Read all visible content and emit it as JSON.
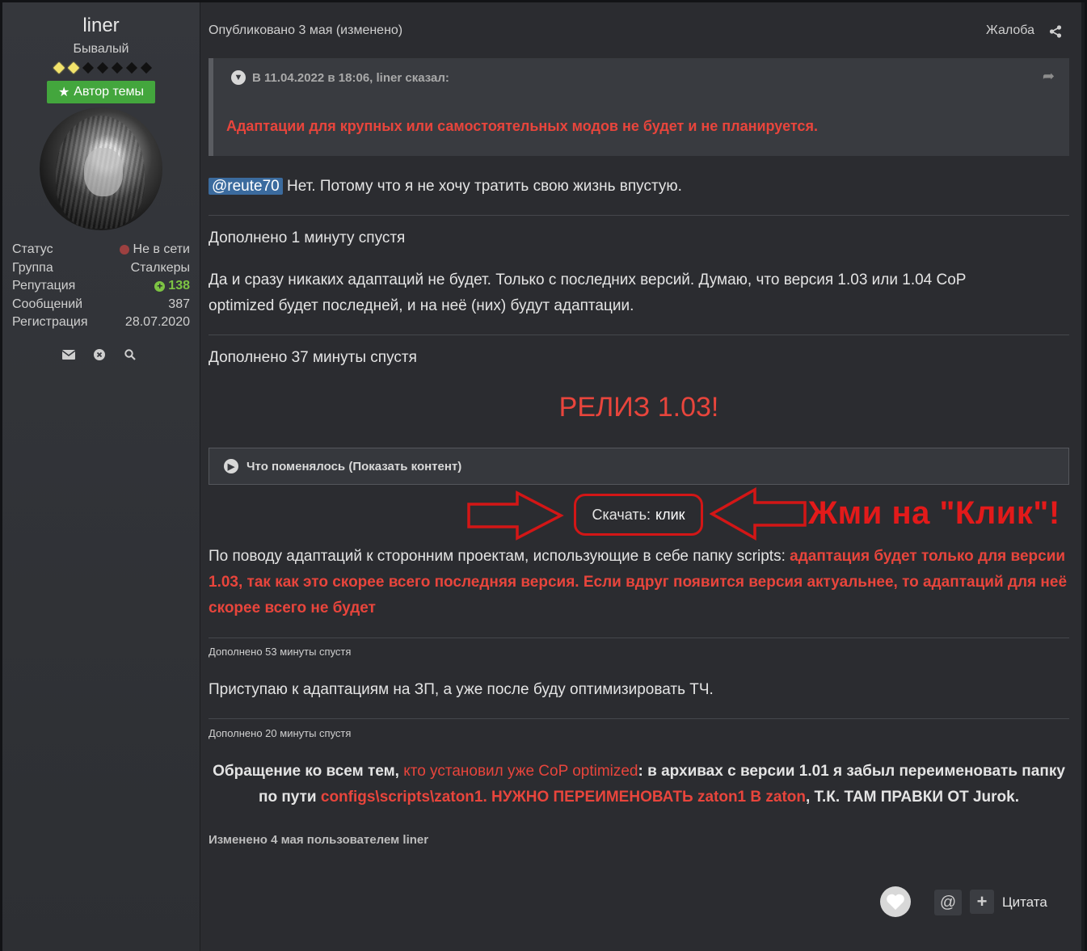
{
  "sidebar": {
    "username": "liner",
    "rank": "Бывалый",
    "rank_pips_on": 2,
    "rank_pips_total": 7,
    "author_badge": "Автор темы",
    "stats": [
      {
        "label": "Статус",
        "value": "Не в сети"
      },
      {
        "label": "Группа",
        "value": "Сталкеры"
      },
      {
        "label": "Репутация",
        "value": "138"
      },
      {
        "label": "Сообщений",
        "value": "387"
      },
      {
        "label": "Регистрация",
        "value": "28.07.2020"
      }
    ]
  },
  "post": {
    "meta": "Опубликовано 3 мая (изменено)",
    "report": "Жалоба",
    "quote": {
      "header": "В 11.04.2022 в 18:06, liner сказал:",
      "text": "Адаптации для крупных или самостоятельных модов не будет и не планируется."
    },
    "mention": "@reute70",
    "reply_text": " Нет. Потому что я не хочу тратить свою жизнь впустую.",
    "added1": "Дополнено 1 минуту спустя",
    "para1_line1": "Да и сразу никаких адаптаций не будет. Только с последних версий. Думаю, что версия 1.03 или 1.04 CoP",
    "para1_line2": "optimized будет последней, и на неё (них) будут адаптации.",
    "added2": "Дополнено 37 минуты спустя",
    "release": "РЕЛИЗ 1.03!",
    "spoiler": "Что поменялось (Показать контент)",
    "download_label": "Скачать:",
    "download_link": "клик",
    "annotation": "Жми на \"Клик\"!",
    "para2_plain": "По поводу адаптаций к сторонним проектам, использующие в себе папку scripts: ",
    "para2_red": "адаптация будет только для версии 1.03, так как это скорее всего последняя версия. Если вдруг появится версия актуальнее, то адаптаций для неё скорее всего не будет",
    "added3": "Дополнено 53 минуты спустя",
    "para3": "Приступаю к адаптациям на ЗП, а уже после буду оптимизировать ТЧ.",
    "added4": "Дополнено 20 минуты спустя",
    "para4_a": "Обращение ко всем тем, ",
    "para4_b": "кто установил уже CoP optimized",
    "para4_c": ": в архивах с версии 1.01 я забыл переименовать папку по пути ",
    "para4_d": "configs\\scripts\\zaton1.  НУЖНО ПЕРЕИМЕНОВАТЬ zaton1 В zaton",
    "para4_e": ", Т.К. ТАМ ПРАВКИ ОТ Jurok.",
    "edited": "Изменено 4 мая пользователем liner",
    "quote_button": "Цитата",
    "mention_button": "@",
    "plus_button": "+"
  },
  "colors": {
    "accent_red": "#e8453c",
    "annotation_red": "#e31a1a",
    "badge_green": "#43a63d",
    "reputation_green": "#7dc443",
    "mention_blue": "#3b6b9e"
  }
}
